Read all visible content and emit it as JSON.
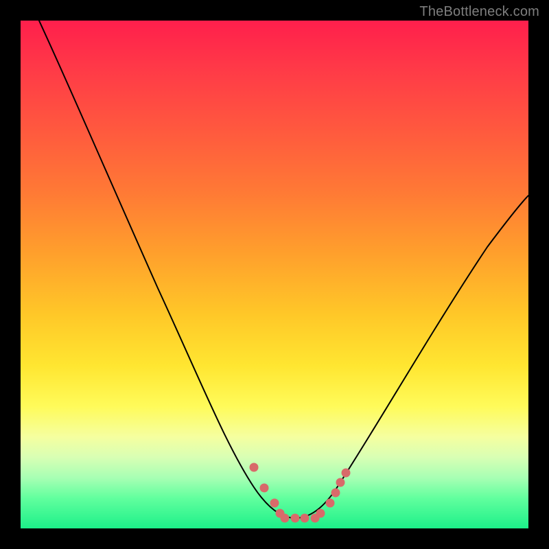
{
  "watermark": "TheBottleneck.com",
  "chart_data": {
    "type": "line",
    "title": "",
    "xlabel": "",
    "ylabel": "",
    "xlim": [
      0,
      100
    ],
    "ylim": [
      0,
      100
    ],
    "grid": false,
    "legend": false,
    "series": [
      {
        "name": "curve",
        "x": [
          0,
          8,
          16,
          24,
          32,
          40,
          46,
          50,
          54,
          58,
          62,
          70,
          78,
          86,
          94,
          100
        ],
        "y": [
          103,
          88,
          72,
          56,
          41,
          25,
          12,
          5,
          2,
          2,
          5,
          16,
          29,
          42,
          55,
          64
        ]
      }
    ],
    "markers": [
      {
        "x": 46,
        "y": 12
      },
      {
        "x": 48,
        "y": 8
      },
      {
        "x": 50,
        "y": 5
      },
      {
        "x": 51,
        "y": 3
      },
      {
        "x": 52,
        "y": 2
      },
      {
        "x": 54,
        "y": 2
      },
      {
        "x": 56,
        "y": 2
      },
      {
        "x": 58,
        "y": 2
      },
      {
        "x": 59,
        "y": 3
      },
      {
        "x": 61,
        "y": 5
      },
      {
        "x": 62,
        "y": 7
      },
      {
        "x": 63,
        "y": 9
      },
      {
        "x": 64,
        "y": 11
      }
    ],
    "marker_color": "#d86a6a",
    "line_color": "#000000",
    "gradient_colors": [
      "#ff1f4c",
      "#ffe631",
      "#1cf089"
    ]
  }
}
